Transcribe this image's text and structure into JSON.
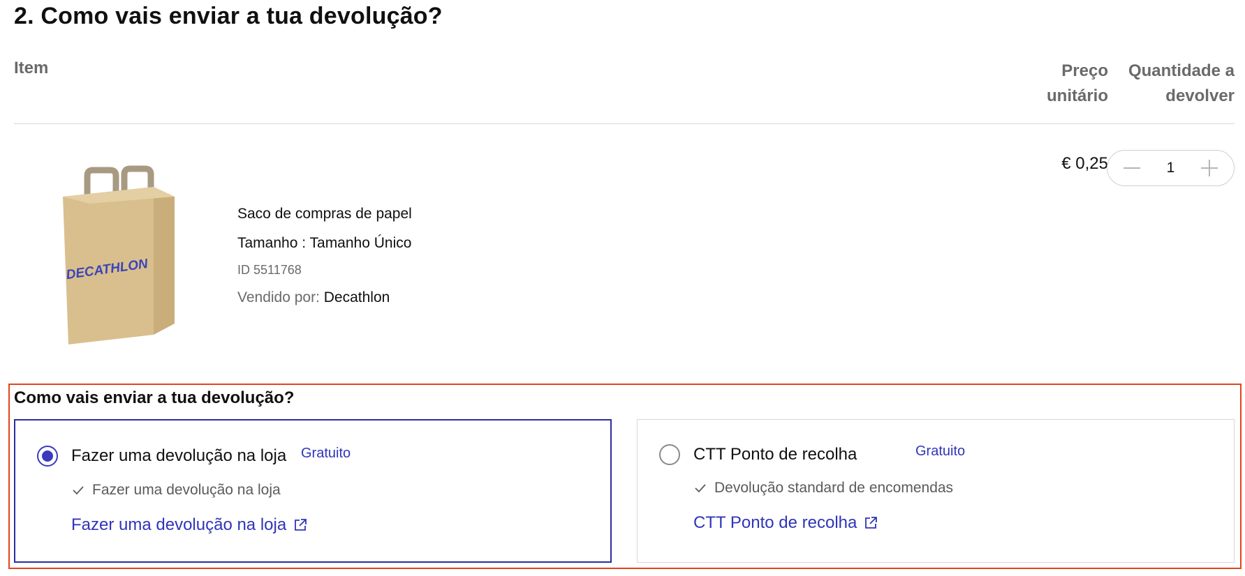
{
  "page": {
    "title": "2. Como vais enviar a tua devolução?"
  },
  "table": {
    "col_item": "Item",
    "col_price_line1": "Preço",
    "col_price_line2": "unitário",
    "col_qty_line1": "Quantidade a",
    "col_qty_line2": "devolver"
  },
  "product": {
    "image_brand": "DECATHLON",
    "name": "Saco de compras de papel",
    "size": "Tamanho : Tamanho Único",
    "id": "ID 5511768",
    "seller_label": "Vendido por: ",
    "seller_name": "Decathlon",
    "unit_price": "€ 0,25",
    "quantity": "1"
  },
  "shipping": {
    "title": "Como vais enviar a tua devolução?",
    "options": [
      {
        "label": "Fazer uma devolução na loja",
        "price": "Gratuito",
        "selected": true,
        "check_text": "Fazer uma devolução na loja",
        "link_text": "Fazer uma devolução na loja"
      },
      {
        "label": "CTT Ponto de recolha",
        "price": "Gratuito",
        "selected": false,
        "check_text": "Devolução standard de encomendas",
        "link_text": "CTT Ponto de recolha"
      }
    ]
  },
  "colors": {
    "accent": "#2f35b8",
    "highlight_border": "#e0451c",
    "bag": "#d9bf8e"
  }
}
